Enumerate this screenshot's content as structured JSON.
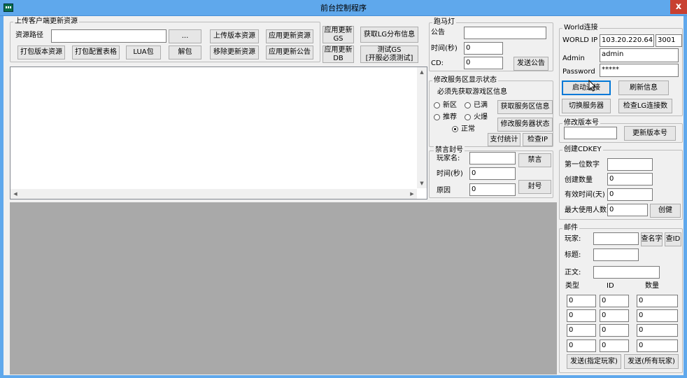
{
  "window": {
    "title": "前台控制程序",
    "close_glyph": "x"
  },
  "upload": {
    "group_title": "上传客户端更新资源",
    "path_label": "资源路径",
    "path_value": "",
    "browse_btn": "...",
    "upload_version_btn": "上传版本资源",
    "apply_update_btn": "应用更新资源",
    "apply_gs_btn_l1": "应用更新",
    "apply_gs_btn_l2": "GS",
    "get_lg_btn": "获取LG分布信息",
    "pack_version_btn": "打包版本资源",
    "pack_config_btn": "打包配置表格",
    "lua_btn": "LUA包",
    "unpack_btn": "解包",
    "remove_update_btn": "移除更新资源",
    "apply_notice_btn": "应用更新公告",
    "apply_db_btn_l1": "应用更新",
    "apply_db_btn_l2": "DB",
    "test_gs_btn_l1": "测试GS",
    "test_gs_btn_l2": "[开服必须测试]"
  },
  "marquee": {
    "group_title": "跑马灯",
    "notice_label": "公告",
    "notice_value": "",
    "time_label": "时间(秒)",
    "time_value": "0",
    "cd_label": "CD:",
    "cd_value": "0",
    "send_btn": "发送公告"
  },
  "server_status": {
    "group_title": "修改服务区显示状态",
    "hint": "必须先获取游戏区信息",
    "opt_new": "新区",
    "opt_full": "已满",
    "opt_recommend": "推荐",
    "opt_hot": "火爆",
    "opt_normal": "正常",
    "get_info_btn": "获取服务区信息",
    "modify_btn": "修改服务器状态",
    "pay_stats_btn": "支付统计",
    "check_ip_btn": "检查IP"
  },
  "ban": {
    "group_title": "禁言封号",
    "player_label": "玩家名:",
    "player_value": "",
    "time_label": "时间(秒)",
    "time_value": "0",
    "reason_label": "原因",
    "reason_value": "0",
    "mute_btn": "禁言",
    "ban_btn": "封号"
  },
  "world": {
    "group_title": "World连接",
    "ip_label": "WORLD IP",
    "ip_value": "103.20.220.64",
    "port_value": "3001",
    "admin_label": "Admin",
    "admin_value": "admin",
    "password_label": "Password",
    "password_value": "*****",
    "connect_btn": "启动连接",
    "refresh_btn": "刷新信息",
    "switch_btn": "切换服务器",
    "check_lg_btn": "检查LG连接数"
  },
  "version": {
    "group_title": "修改版本号",
    "version_value": "",
    "update_btn": "更新版本号"
  },
  "cdkey": {
    "group_title": "创建CDKEY",
    "first_digit_label": "第一位数字",
    "first_digit_value": "",
    "count_label": "创建数量",
    "count_value": "0",
    "valid_label": "有效时间(天)",
    "valid_value": "0",
    "max_use_label": "最大使用人数",
    "max_use_value": "0",
    "create_btn": "创健"
  },
  "mail": {
    "group_title": "邮件",
    "player_label": "玩家:",
    "player_value": "",
    "query_name_btn": "查名字",
    "query_id_btn": "查ID",
    "subject_label": "标题:",
    "subject_value": "",
    "body_label": "正文:",
    "body_value": "",
    "col_type": "类型",
    "col_id": "ID",
    "col_qty": "数量",
    "rows": [
      {
        "type": "0",
        "id": "0",
        "qty": "0"
      },
      {
        "type": "0",
        "id": "0",
        "qty": "0"
      },
      {
        "type": "0",
        "id": "0",
        "qty": "0"
      },
      {
        "type": "0",
        "id": "0",
        "qty": "0"
      }
    ],
    "send_player_btn": "发送(指定玩家)",
    "send_all_btn": "发送(所有玩家)"
  },
  "log": {
    "text": ""
  }
}
